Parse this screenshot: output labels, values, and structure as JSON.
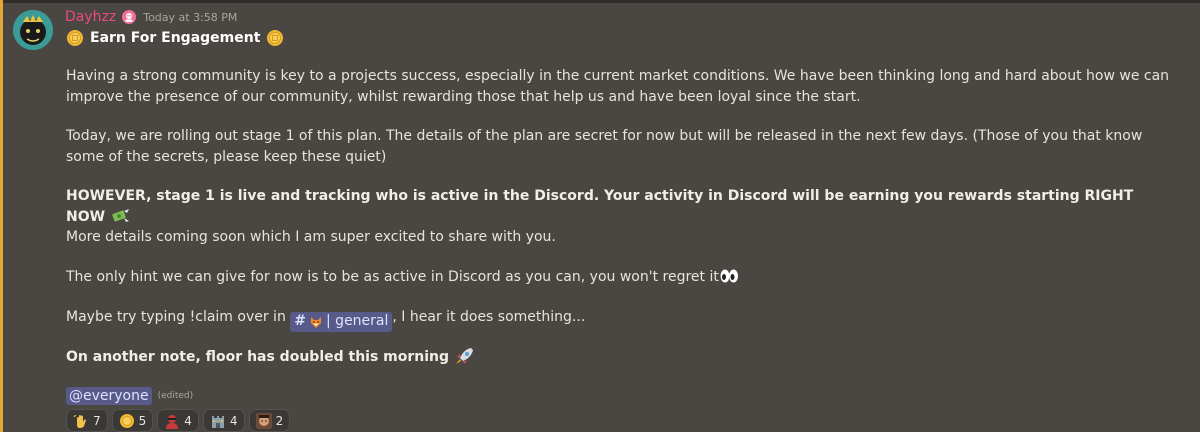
{
  "message": {
    "username": "Dayhzz",
    "timestamp": "Today at 3:58 PM",
    "title": "Earn For Engagement",
    "paragraphs": {
      "p1": "Having a strong community is key to a projects success, especially in the current market conditions. We have been thinking long and hard about how we can improve the presence of our community, whilst rewarding those that help us and have been loyal since the start.",
      "p2": "Today, we are rolling out stage 1 of this plan. The details of the plan are secret for now but will be released in the next few days.  (Those of you that know some of the secrets, please keep these quiet)",
      "p3": "HOWEVER, stage 1 is live and tracking who is active in the Discord. Your activity in Discord will be earning you rewards starting RIGHT NOW",
      "p4": "More details coming soon which I am super excited to share with you.",
      "p5": "The only hint we can give for now is to be as active in Discord as you can, you won't regret it",
      "p6_before": "Maybe try typing !claim over in",
      "p6_after": ", I hear it does something...",
      "p7": "On another note, floor has doubled this morning"
    },
    "channel_mention": {
      "hash": "#",
      "name": "| general"
    },
    "everyone_mention": "@everyone",
    "edited_label": "(edited)",
    "reactions": [
      {
        "icon": "waving-hand-icon",
        "count": "7"
      },
      {
        "icon": "coin-icon",
        "count": "5"
      },
      {
        "icon": "person-mask-icon",
        "count": "4"
      },
      {
        "icon": "castle-icon",
        "count": "4"
      },
      {
        "icon": "face-avatar-icon",
        "count": "2"
      }
    ],
    "colors": {
      "background": "#4a4742",
      "username": "#ea4a83",
      "accent_bar": "#e3a83a",
      "mention_bg": "#585a8a"
    }
  }
}
